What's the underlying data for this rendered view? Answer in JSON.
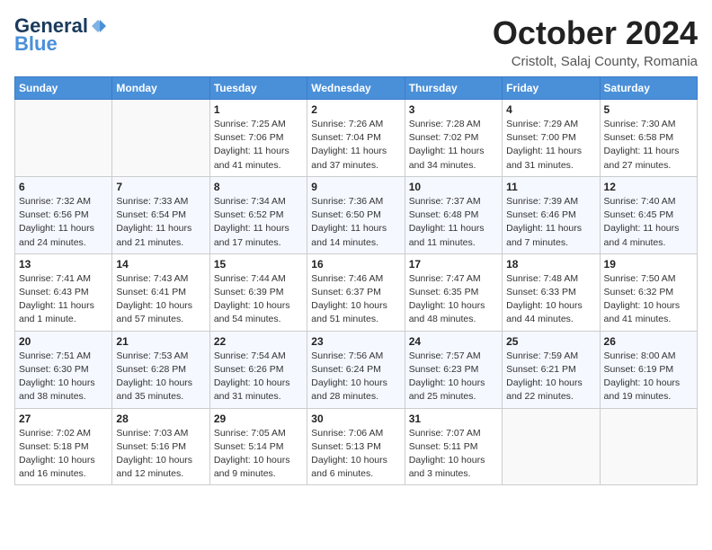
{
  "header": {
    "logo_line1": "General",
    "logo_line2": "Blue",
    "month": "October 2024",
    "location": "Cristolt, Salaj County, Romania"
  },
  "weekdays": [
    "Sunday",
    "Monday",
    "Tuesday",
    "Wednesday",
    "Thursday",
    "Friday",
    "Saturday"
  ],
  "weeks": [
    [
      {
        "day": "",
        "info": ""
      },
      {
        "day": "",
        "info": ""
      },
      {
        "day": "1",
        "sunrise": "Sunrise: 7:25 AM",
        "sunset": "Sunset: 7:06 PM",
        "daylight": "Daylight: 11 hours and 41 minutes."
      },
      {
        "day": "2",
        "sunrise": "Sunrise: 7:26 AM",
        "sunset": "Sunset: 7:04 PM",
        "daylight": "Daylight: 11 hours and 37 minutes."
      },
      {
        "day": "3",
        "sunrise": "Sunrise: 7:28 AM",
        "sunset": "Sunset: 7:02 PM",
        "daylight": "Daylight: 11 hours and 34 minutes."
      },
      {
        "day": "4",
        "sunrise": "Sunrise: 7:29 AM",
        "sunset": "Sunset: 7:00 PM",
        "daylight": "Daylight: 11 hours and 31 minutes."
      },
      {
        "day": "5",
        "sunrise": "Sunrise: 7:30 AM",
        "sunset": "Sunset: 6:58 PM",
        "daylight": "Daylight: 11 hours and 27 minutes."
      }
    ],
    [
      {
        "day": "6",
        "sunrise": "Sunrise: 7:32 AM",
        "sunset": "Sunset: 6:56 PM",
        "daylight": "Daylight: 11 hours and 24 minutes."
      },
      {
        "day": "7",
        "sunrise": "Sunrise: 7:33 AM",
        "sunset": "Sunset: 6:54 PM",
        "daylight": "Daylight: 11 hours and 21 minutes."
      },
      {
        "day": "8",
        "sunrise": "Sunrise: 7:34 AM",
        "sunset": "Sunset: 6:52 PM",
        "daylight": "Daylight: 11 hours and 17 minutes."
      },
      {
        "day": "9",
        "sunrise": "Sunrise: 7:36 AM",
        "sunset": "Sunset: 6:50 PM",
        "daylight": "Daylight: 11 hours and 14 minutes."
      },
      {
        "day": "10",
        "sunrise": "Sunrise: 7:37 AM",
        "sunset": "Sunset: 6:48 PM",
        "daylight": "Daylight: 11 hours and 11 minutes."
      },
      {
        "day": "11",
        "sunrise": "Sunrise: 7:39 AM",
        "sunset": "Sunset: 6:46 PM",
        "daylight": "Daylight: 11 hours and 7 minutes."
      },
      {
        "day": "12",
        "sunrise": "Sunrise: 7:40 AM",
        "sunset": "Sunset: 6:45 PM",
        "daylight": "Daylight: 11 hours and 4 minutes."
      }
    ],
    [
      {
        "day": "13",
        "sunrise": "Sunrise: 7:41 AM",
        "sunset": "Sunset: 6:43 PM",
        "daylight": "Daylight: 11 hours and 1 minute."
      },
      {
        "day": "14",
        "sunrise": "Sunrise: 7:43 AM",
        "sunset": "Sunset: 6:41 PM",
        "daylight": "Daylight: 10 hours and 57 minutes."
      },
      {
        "day": "15",
        "sunrise": "Sunrise: 7:44 AM",
        "sunset": "Sunset: 6:39 PM",
        "daylight": "Daylight: 10 hours and 54 minutes."
      },
      {
        "day": "16",
        "sunrise": "Sunrise: 7:46 AM",
        "sunset": "Sunset: 6:37 PM",
        "daylight": "Daylight: 10 hours and 51 minutes."
      },
      {
        "day": "17",
        "sunrise": "Sunrise: 7:47 AM",
        "sunset": "Sunset: 6:35 PM",
        "daylight": "Daylight: 10 hours and 48 minutes."
      },
      {
        "day": "18",
        "sunrise": "Sunrise: 7:48 AM",
        "sunset": "Sunset: 6:33 PM",
        "daylight": "Daylight: 10 hours and 44 minutes."
      },
      {
        "day": "19",
        "sunrise": "Sunrise: 7:50 AM",
        "sunset": "Sunset: 6:32 PM",
        "daylight": "Daylight: 10 hours and 41 minutes."
      }
    ],
    [
      {
        "day": "20",
        "sunrise": "Sunrise: 7:51 AM",
        "sunset": "Sunset: 6:30 PM",
        "daylight": "Daylight: 10 hours and 38 minutes."
      },
      {
        "day": "21",
        "sunrise": "Sunrise: 7:53 AM",
        "sunset": "Sunset: 6:28 PM",
        "daylight": "Daylight: 10 hours and 35 minutes."
      },
      {
        "day": "22",
        "sunrise": "Sunrise: 7:54 AM",
        "sunset": "Sunset: 6:26 PM",
        "daylight": "Daylight: 10 hours and 31 minutes."
      },
      {
        "day": "23",
        "sunrise": "Sunrise: 7:56 AM",
        "sunset": "Sunset: 6:24 PM",
        "daylight": "Daylight: 10 hours and 28 minutes."
      },
      {
        "day": "24",
        "sunrise": "Sunrise: 7:57 AM",
        "sunset": "Sunset: 6:23 PM",
        "daylight": "Daylight: 10 hours and 25 minutes."
      },
      {
        "day": "25",
        "sunrise": "Sunrise: 7:59 AM",
        "sunset": "Sunset: 6:21 PM",
        "daylight": "Daylight: 10 hours and 22 minutes."
      },
      {
        "day": "26",
        "sunrise": "Sunrise: 8:00 AM",
        "sunset": "Sunset: 6:19 PM",
        "daylight": "Daylight: 10 hours and 19 minutes."
      }
    ],
    [
      {
        "day": "27",
        "sunrise": "Sunrise: 7:02 AM",
        "sunset": "Sunset: 5:18 PM",
        "daylight": "Daylight: 10 hours and 16 minutes."
      },
      {
        "day": "28",
        "sunrise": "Sunrise: 7:03 AM",
        "sunset": "Sunset: 5:16 PM",
        "daylight": "Daylight: 10 hours and 12 minutes."
      },
      {
        "day": "29",
        "sunrise": "Sunrise: 7:05 AM",
        "sunset": "Sunset: 5:14 PM",
        "daylight": "Daylight: 10 hours and 9 minutes."
      },
      {
        "day": "30",
        "sunrise": "Sunrise: 7:06 AM",
        "sunset": "Sunset: 5:13 PM",
        "daylight": "Daylight: 10 hours and 6 minutes."
      },
      {
        "day": "31",
        "sunrise": "Sunrise: 7:07 AM",
        "sunset": "Sunset: 5:11 PM",
        "daylight": "Daylight: 10 hours and 3 minutes."
      },
      {
        "day": "",
        "info": ""
      },
      {
        "day": "",
        "info": ""
      }
    ]
  ]
}
